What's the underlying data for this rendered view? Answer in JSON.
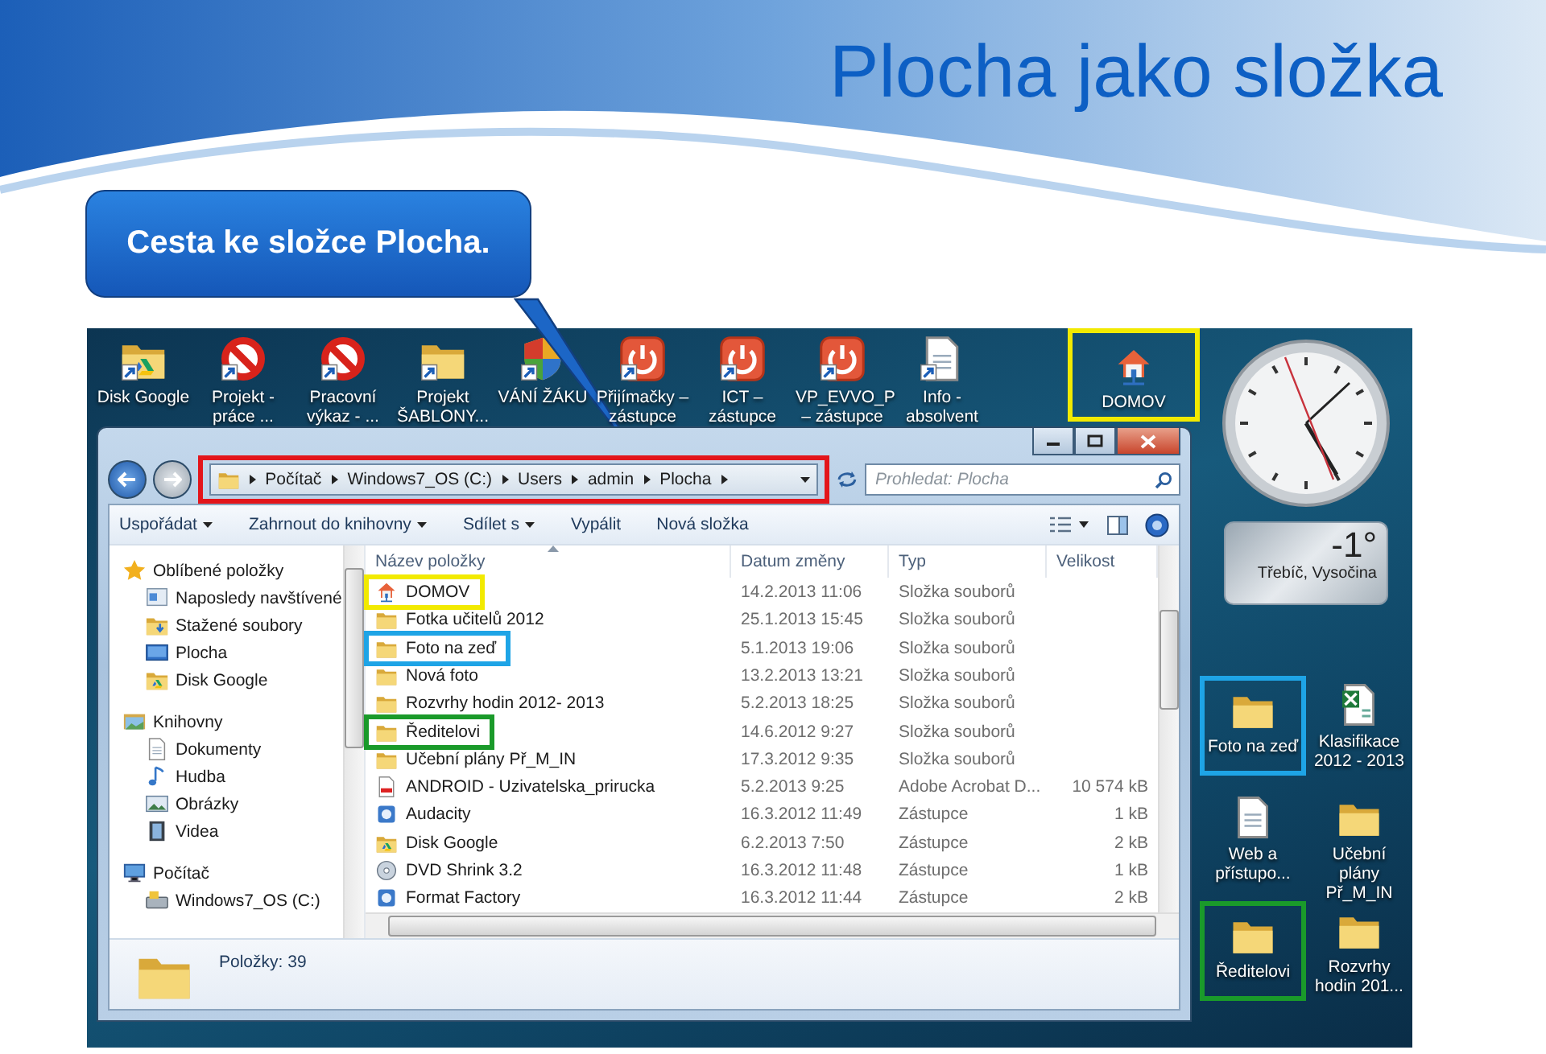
{
  "title": "Plocha jako složka",
  "callout": {
    "text": "Cesta ke složce Plocha."
  },
  "desktop": {
    "top_icons": [
      {
        "label": "Disk Google",
        "kind": "drive",
        "shortcut": true
      },
      {
        "label": "Projekt - práce ...",
        "kind": "forbidden",
        "shortcut": true
      },
      {
        "label": "Pracovní výkaz - ...",
        "kind": "forbidden",
        "shortcut": true
      },
      {
        "label": "Projekt ŠABLONY...",
        "kind": "folder",
        "shortcut": true
      },
      {
        "label": "VÁNÍ ŽÁKU",
        "kind": "shield",
        "shortcut": true
      },
      {
        "label": "Přijímačky – zástupce",
        "kind": "power",
        "shortcut": true
      },
      {
        "label": "ICT – zástupce",
        "kind": "power",
        "shortcut": true
      },
      {
        "label": "VP_EVVO_P – zástupce",
        "kind": "power",
        "shortcut": true
      },
      {
        "label": "Info - absolvent",
        "kind": "document",
        "shortcut": true
      },
      {
        "label": "DOMOV",
        "kind": "home",
        "shortcut": false,
        "color": "#f2ea00"
      }
    ],
    "weather": {
      "temperature": "-1°",
      "location": "Třebíč, Vysočina"
    },
    "side_icons": [
      {
        "label": "Foto na zeď",
        "kind": "folder",
        "shortcut": false,
        "color": "#1ea4e6"
      },
      {
        "label": "Klasifikace 2012 - 2013",
        "kind": "spreadsheet",
        "shortcut": false
      },
      {
        "label": "Web a přístupo...",
        "kind": "document",
        "shortcut": false
      },
      {
        "label": "Učební plány Př_M_IN",
        "kind": "folder",
        "shortcut": false
      },
      {
        "label": "Ředitelovi",
        "kind": "folder",
        "shortcut": false,
        "color": "#1a9a2a"
      },
      {
        "label": "Rozvrhy hodin 201...",
        "kind": "folder",
        "shortcut": false
      }
    ]
  },
  "explorer": {
    "back": {
      "disabled": false
    },
    "forward": {
      "disabled": true
    },
    "address": {
      "segments": [
        "Počítač",
        "Windows7_OS (C:)",
        "Users",
        "admin",
        "Plocha"
      ],
      "color": "#e3151b"
    },
    "search": {
      "placeholder": "Prohledat: Plocha"
    },
    "toolbar": [
      {
        "label": "Uspořádat",
        "dropdown": true
      },
      {
        "label": "Zahrnout do knihovny",
        "dropdown": true
      },
      {
        "label": "Sdílet s",
        "dropdown": true
      },
      {
        "label": "Vypálit",
        "dropdown": false
      },
      {
        "label": "Nová složka",
        "dropdown": false
      }
    ],
    "nav": [
      {
        "label": "Oblíbené položky",
        "kind": "star",
        "children": [
          {
            "label": "Naposledy navštívené",
            "kind": "recent"
          },
          {
            "label": "Stažené soubory",
            "kind": "download"
          },
          {
            "label": "Plocha",
            "kind": "desktop"
          },
          {
            "label": "Disk Google",
            "kind": "drive"
          }
        ]
      },
      {
        "label": "Knihovny",
        "kind": "library",
        "children": [
          {
            "label": "Dokumenty",
            "kind": "document"
          },
          {
            "label": "Hudba",
            "kind": "music"
          },
          {
            "label": "Obrázky",
            "kind": "picture"
          },
          {
            "label": "Videa",
            "kind": "video"
          }
        ]
      },
      {
        "label": "Počítač",
        "kind": "computer",
        "children": [
          {
            "label": "Windows7_OS (C:)",
            "kind": "hdd"
          }
        ]
      }
    ],
    "columns": [
      {
        "label": "Název položky",
        "sorted": true
      },
      {
        "label": "Datum změny",
        "sorted": false
      },
      {
        "label": "Typ",
        "sorted": false
      },
      {
        "label": "Velikost",
        "sorted": false
      }
    ],
    "rows": [
      {
        "name": "DOMOV",
        "kind": "home",
        "date": "14.2.2013 11:06",
        "type": "Složka souborů",
        "color": "#f2ea00"
      },
      {
        "name": "Fotka učitelů 2012",
        "kind": "folder",
        "date": "25.1.2013 15:45",
        "type": "Složka souborů"
      },
      {
        "name": "Foto na zeď",
        "kind": "folder",
        "date": "5.1.2013 19:06",
        "type": "Složka souborů",
        "color": "#1ea4e6"
      },
      {
        "name": "Nová foto",
        "kind": "folder",
        "date": "13.2.2013 13:21",
        "type": "Složka souborů"
      },
      {
        "name": "Rozvrhy hodin 2012- 2013",
        "kind": "folder",
        "date": "5.2.2013 18:25",
        "type": "Složka souborů"
      },
      {
        "name": "Ředitelovi",
        "kind": "folder",
        "date": "14.6.2012 9:27",
        "type": "Složka souborů",
        "color": "#1a9a2a"
      },
      {
        "name": "Učební plány Př_M_IN",
        "kind": "folder",
        "date": "17.3.2012 9:35",
        "type": "Složka souborů"
      },
      {
        "name": "ANDROID - Uzivatelska_prirucka",
        "kind": "pdf",
        "date": "5.2.2013 9:25",
        "type": "Adobe Acrobat D...",
        "size": "10 574 kB"
      },
      {
        "name": "Audacity",
        "kind": "app",
        "date": "16.3.2012 11:49",
        "type": "Zástupce",
        "size": "1 kB"
      },
      {
        "name": "Disk Google",
        "kind": "drive",
        "date": "6.2.2013 7:50",
        "type": "Zástupce",
        "size": "2 kB"
      },
      {
        "name": "DVD Shrink 3.2",
        "kind": "disc",
        "date": "16.3.2012 11:48",
        "type": "Zástupce",
        "size": "1 kB"
      },
      {
        "name": "Format Factory",
        "kind": "app",
        "date": "16.3.2012 11:44",
        "type": "Zástupce",
        "size": "2 kB"
      }
    ],
    "status": {
      "text": "Položky: 39"
    }
  }
}
